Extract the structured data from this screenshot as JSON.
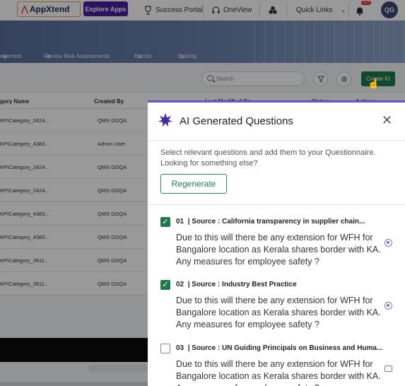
{
  "topbar": {
    "brand": "AppXtend",
    "explore_label": "Explore Apps",
    "nav": [
      {
        "label": "Success Portal",
        "icon": "trophy-icon"
      },
      {
        "label": "OneView",
        "icon": "headset-icon"
      },
      {
        "label": "",
        "icon": "apps-logo-icon"
      },
      {
        "label": "Quick Links",
        "icon": "chevron-down-icon"
      }
    ],
    "notification_count": "119",
    "avatar_initials": "QG"
  },
  "tabs": [
    "essment",
    "Review Risk Assessments",
    "Events",
    "Scoring"
  ],
  "toolbar": {
    "search_placeholder": "Search",
    "create_label": "Create KI"
  },
  "table": {
    "headers": [
      "gory Name",
      "Created By",
      "Last Modified On",
      "Status",
      "Actions"
    ],
    "rows": [
      {
        "name": "KPICategory_2424...",
        "created_by": "QMS GDQA"
      },
      {
        "name": "KPICategory_4383...",
        "created_by": "Admin User"
      },
      {
        "name": "KPICategory_2424...",
        "created_by": "QMS GDQA"
      },
      {
        "name": "KPICategory_2424...",
        "created_by": "QMS GDQA"
      },
      {
        "name": "KPICategory_4383...",
        "created_by": "QMS GDQA"
      },
      {
        "name": "KPICategory_4383...",
        "created_by": "QMS GDQA"
      },
      {
        "name": "KPICategory_3911...",
        "created_by": "QMS GDQA"
      },
      {
        "name": "KPICategory_3911...",
        "created_by": "QMS GDQA"
      }
    ]
  },
  "panel": {
    "title": "AI Generated Questions",
    "intro": "Select relevant questions and add them to your Questionnaire. Looking for something else?",
    "regenerate_label": "Regenerate",
    "questions": [
      {
        "num": "01",
        "source": "| Source : California transparency in supplier chain...",
        "text": "Due to this will there be any extension for WFH for Bangalore location as Kerala shares border with KA. Any measures for employee safety ?",
        "checked": true
      },
      {
        "num": "02",
        "source": "| Source : Industry Best Practice",
        "text": "Due to this will there be any extension for WFH for Bangalore location as Kerala shares border with KA. Any measures for employee safety ?",
        "checked": true
      },
      {
        "num": "03",
        "source": "| Source : UN Guiding Principals on Business and Huma...",
        "text": "Due to this will there be any extension for WFH for Bangalore location as Kerala shares border with KA. Any measures for employee safety ?",
        "checked": false
      }
    ]
  }
}
